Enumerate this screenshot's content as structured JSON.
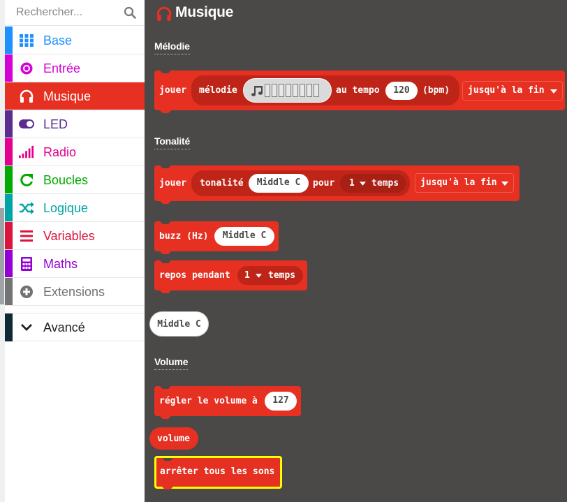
{
  "search": {
    "placeholder": "Rechercher..."
  },
  "categories": [
    {
      "label": "Base",
      "color": "#1e90ff",
      "icon": "grid-icon"
    },
    {
      "label": "Entrée",
      "color": "#d400d4",
      "icon": "radio-button-icon"
    },
    {
      "label": "Musique",
      "color": "#e63022",
      "icon": "headphones-icon"
    },
    {
      "label": "LED",
      "color": "#5c2d91",
      "icon": "toggle-icon"
    },
    {
      "label": "Radio",
      "color": "#e3008c",
      "icon": "signal-bars-icon"
    },
    {
      "label": "Boucles",
      "color": "#00aa00",
      "icon": "refresh-icon"
    },
    {
      "label": "Logique",
      "color": "#00a4a6",
      "icon": "shuffle-icon"
    },
    {
      "label": "Variables",
      "color": "#dc143c",
      "icon": "list-icon"
    },
    {
      "label": "Maths",
      "color": "#9400d3",
      "icon": "calculator-icon"
    },
    {
      "label": "Extensions",
      "color": "#737373",
      "icon": "plus-circle-icon"
    }
  ],
  "selected_category": "Musique",
  "advanced": {
    "label": "Avancé",
    "icon": "chevron-down-icon"
  },
  "flyout": {
    "title": "Musique",
    "sections": {
      "melody": "Mélodie",
      "tone": "Tonalité",
      "volume": "Volume"
    },
    "blocks": {
      "play_melody": {
        "play": "jouer",
        "melody": "mélodie",
        "at_tempo": "au tempo",
        "tempo": "120",
        "bpm": "(bpm)",
        "mode": "jusqu'à la fin"
      },
      "play_tone": {
        "play": "jouer",
        "tone": "tonalité",
        "note": "Middle C",
        "for": "pour",
        "beats": "1",
        "beats_unit": "temps",
        "mode": "jusqu'à la fin"
      },
      "buzz": {
        "label": "buzz (Hz)",
        "note": "Middle C"
      },
      "rest": {
        "label": "repos pendant",
        "beats": "1",
        "beats_unit": "temps"
      },
      "note_reporter": {
        "label": "Middle C"
      },
      "set_volume": {
        "label": "régler le volume à",
        "value": "127"
      },
      "volume_reporter": {
        "label": "volume"
      },
      "stop_all": {
        "label": "arrêter tous les sons"
      }
    }
  },
  "colors": {
    "music": "#e63022",
    "music_dark": "#be2518",
    "flyout_bg": "#4b4848",
    "highlight": "#ffff00"
  }
}
